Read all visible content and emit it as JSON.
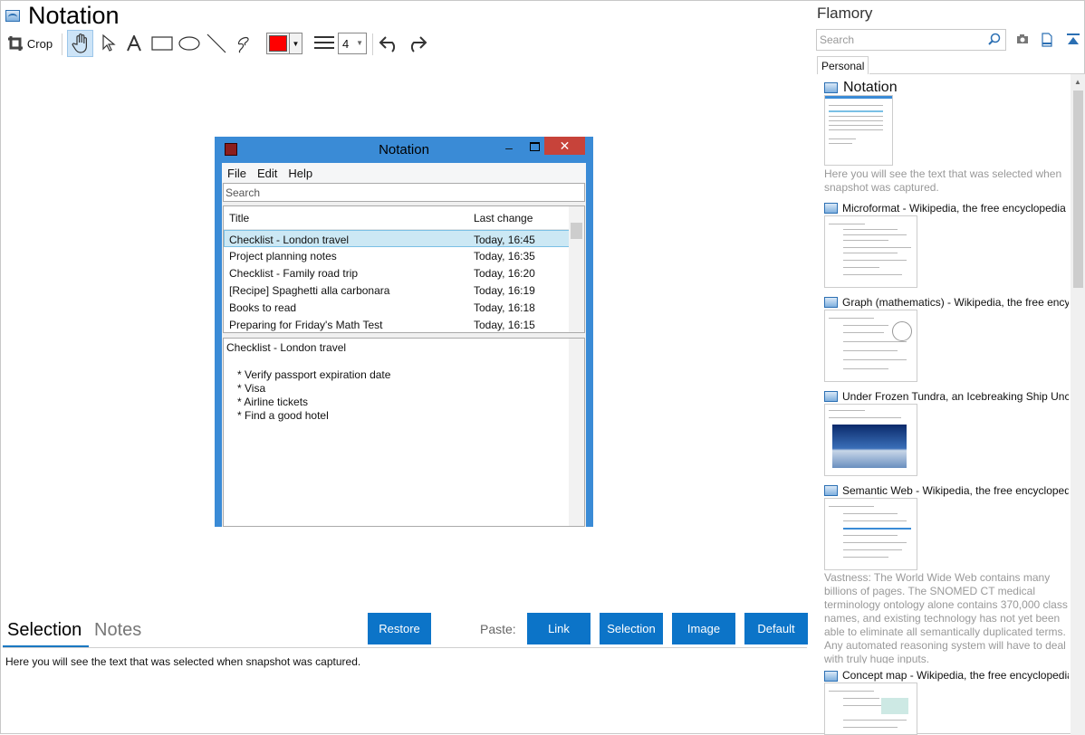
{
  "document": {
    "title": "Notation"
  },
  "toolbar": {
    "crop_label": "Crop",
    "line_width": "4",
    "color": "#ff0000"
  },
  "snapshot": {
    "title": "Notation",
    "menu": [
      "File",
      "Edit",
      "Help"
    ],
    "search_placeholder": "Search",
    "columns": [
      "Title",
      "Last change"
    ],
    "rows": [
      {
        "title": "Checklist - London travel",
        "time": "Today, 16:45"
      },
      {
        "title": "Project planning notes",
        "time": "Today, 16:35"
      },
      {
        "title": "Checklist - Family road trip",
        "time": "Today, 16:20"
      },
      {
        "title": "[Recipe] Spaghetti alla carbonara",
        "time": "Today, 16:19"
      },
      {
        "title": "Books to read",
        "time": "Today, 16:18"
      },
      {
        "title": "Preparing for Friday's Math Test",
        "time": "Today, 16:15"
      }
    ],
    "note_title": "Checklist - London travel",
    "note_lines": [
      "* Verify passport expiration date",
      "* Visa",
      "* Airline tickets",
      "* Find a good hotel"
    ]
  },
  "bottom": {
    "tab_selection": "Selection",
    "tab_notes": "Notes",
    "restore_label": "Restore",
    "paste_label": "Paste:",
    "paste_buttons": [
      "Link",
      "Selection",
      "Image",
      "Default"
    ],
    "selection_text": "Here you will see the text that was selected when snapshot was captured."
  },
  "panel": {
    "title": "Flamory",
    "search_placeholder": "Search",
    "tab": "Personal",
    "entries": [
      {
        "title": "Notation",
        "desc": "Here you will see the text that was selected when snapshot was captured."
      },
      {
        "title": "Microformat - Wikipedia, the free encyclopedia",
        "desc": ""
      },
      {
        "title": "Graph (mathematics) - Wikipedia, the free encyclopedia",
        "desc": ""
      },
      {
        "title": "Under Frozen Tundra, an Icebreaking Ship Uncovers",
        "desc": ""
      },
      {
        "title": "Semantic Web - Wikipedia, the free encyclopedia",
        "desc": "Vastness: The World Wide Web contains many billions of pages. The SNOMED CT medical terminology ontology alone contains 370,000 class names, and existing technology has not yet been able to eliminate all semantically duplicated terms. Any automated reasoning system will have to deal with truly huge inputs."
      },
      {
        "title": "Concept map - Wikipedia, the free encyclopedia",
        "desc": ""
      }
    ]
  }
}
